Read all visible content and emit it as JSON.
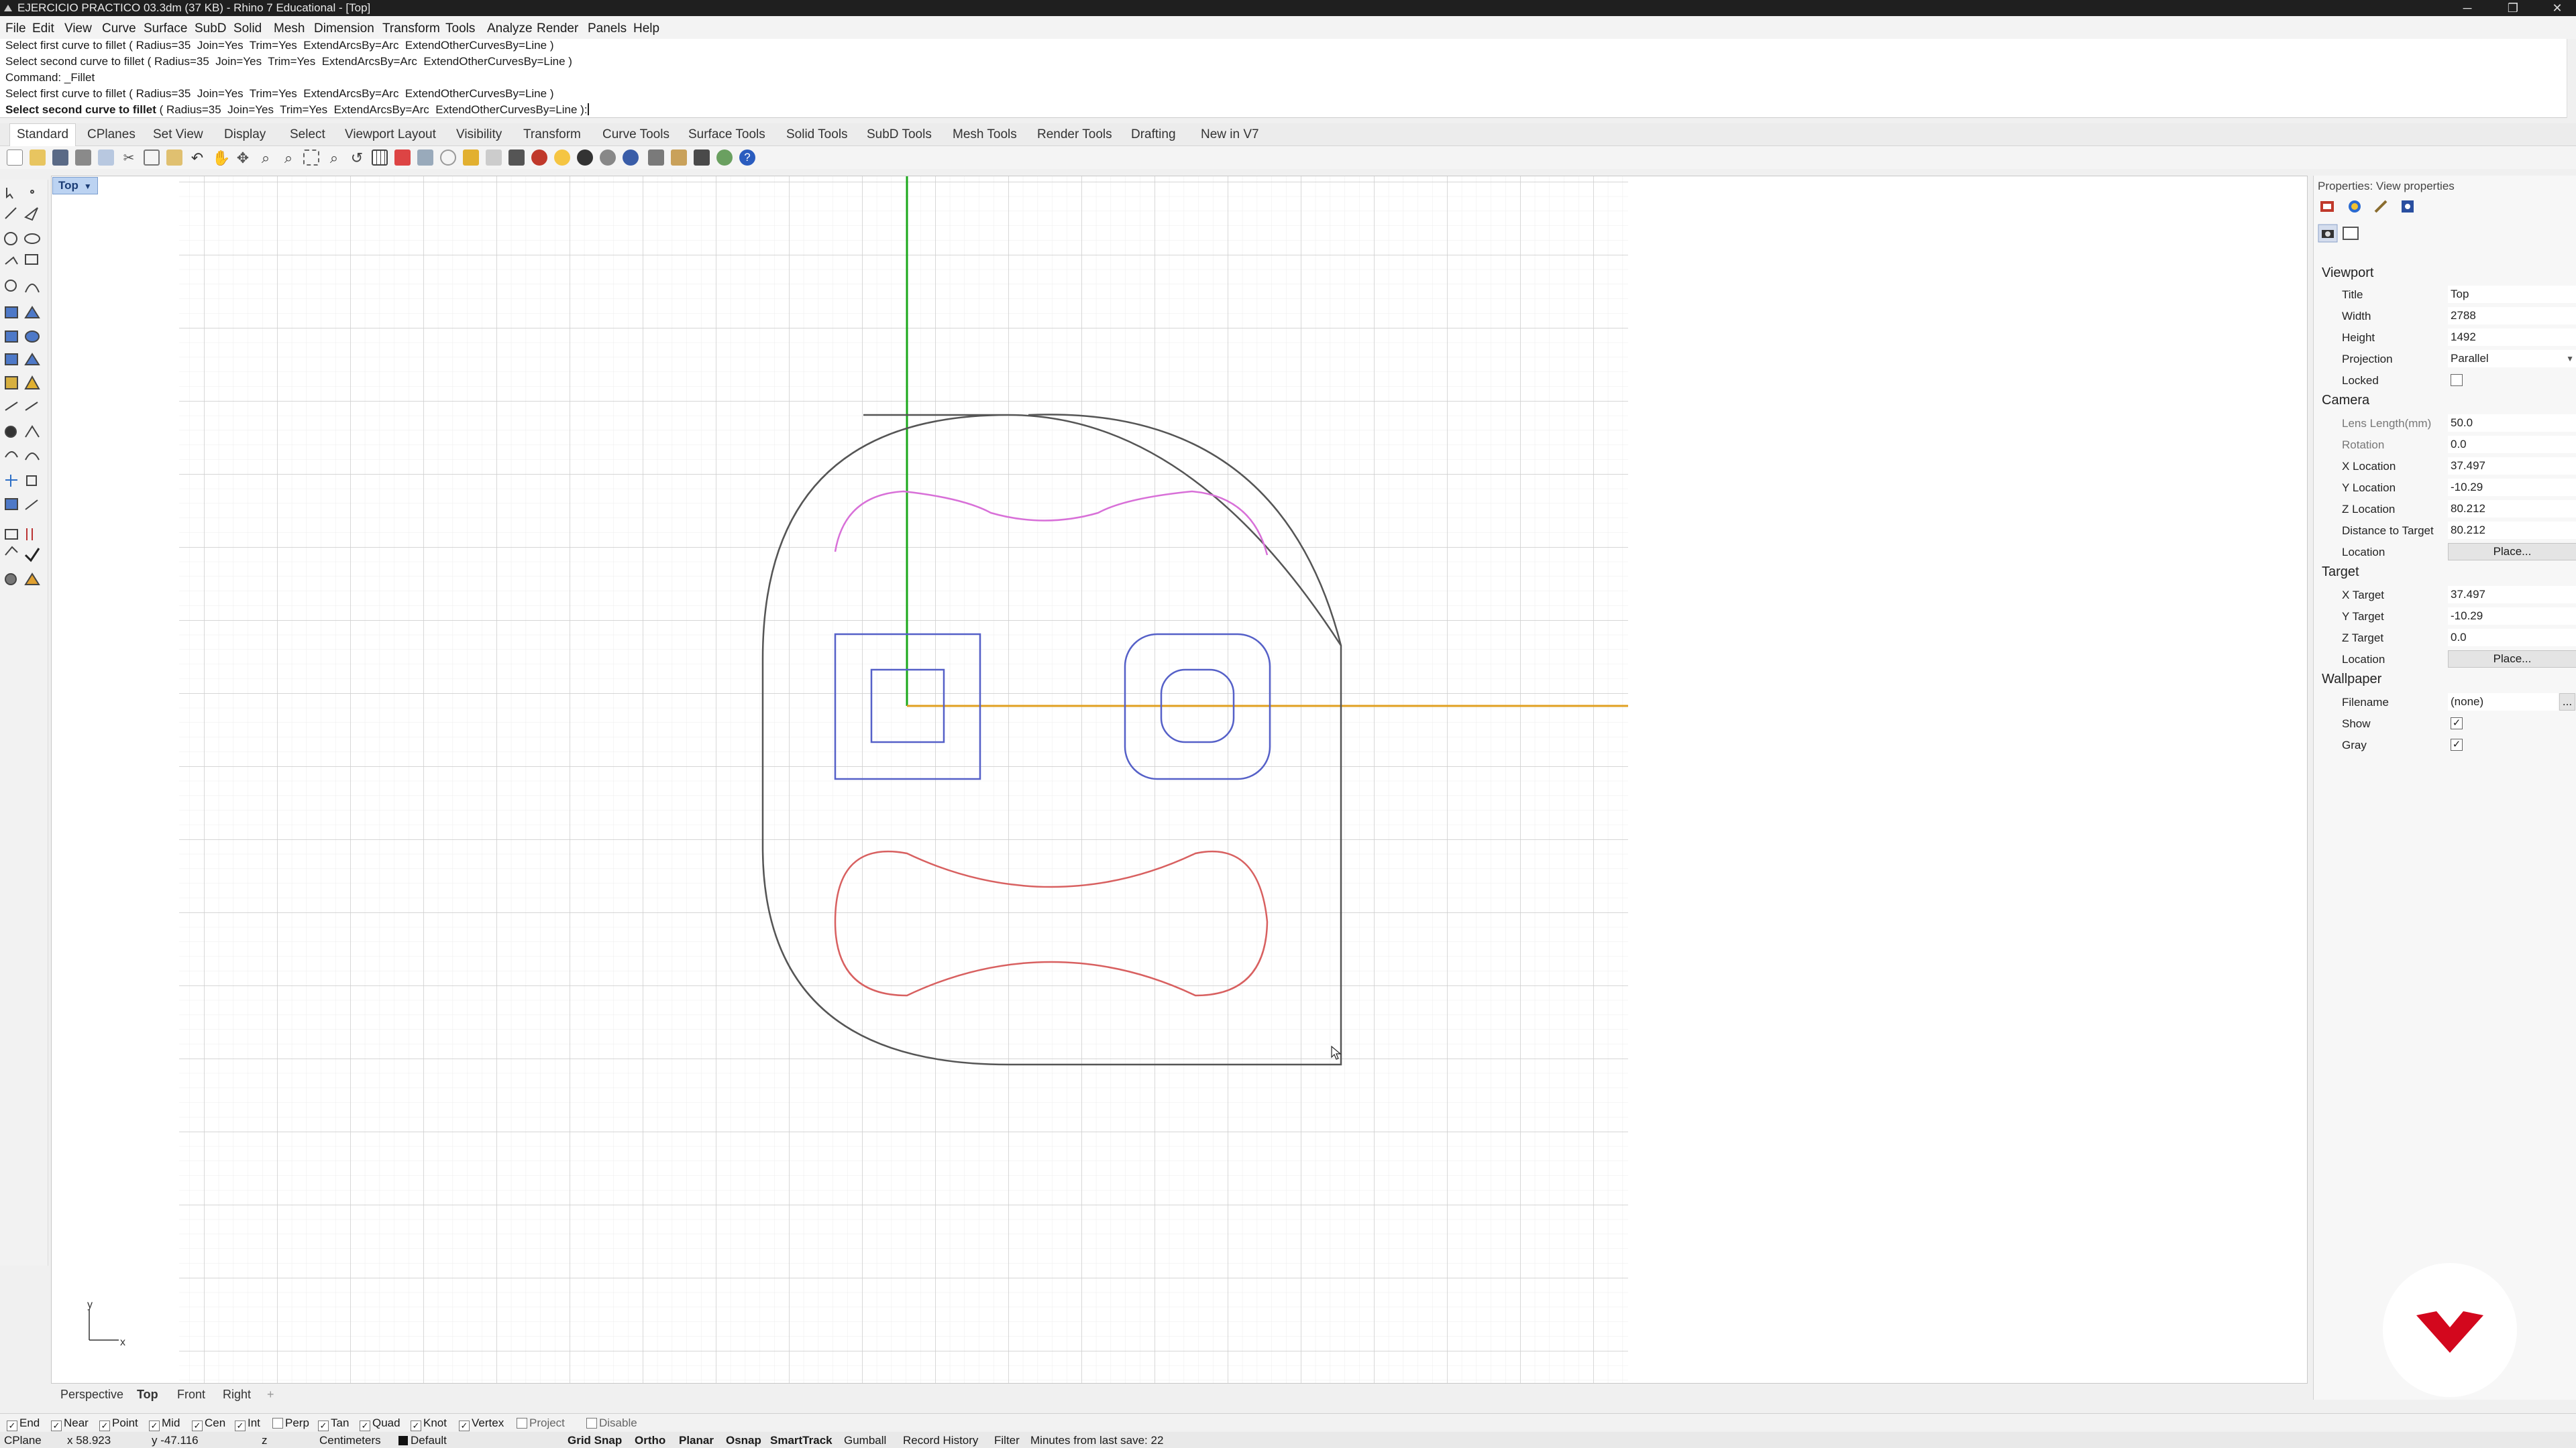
{
  "window": {
    "title": "EJERCICIO PRACTICO 03.3dm (37 KB) - Rhino 7 Educational - [Top]",
    "minimize": "─",
    "restore": "❐",
    "close": "✕"
  },
  "menu": [
    "File",
    "Edit",
    "View",
    "Curve",
    "Surface",
    "SubD",
    "Solid",
    "Mesh",
    "Dimension",
    "Transform",
    "Tools",
    "Analyze",
    "Render",
    "Panels",
    "Help"
  ],
  "command_history": [
    "Select first curve to fillet ( Radius=35  Join=Yes  Trim=Yes  ExtendArcsBy=Arc  ExtendOtherCurvesBy=Line )",
    "Select second curve to fillet ( Radius=35  Join=Yes  Trim=Yes  ExtendArcsBy=Arc  ExtendOtherCurvesBy=Line )",
    "Command: _Fillet",
    "Select first curve to fillet ( Radius=35  Join=Yes  Trim=Yes  ExtendArcsBy=Arc  ExtendOtherCurvesBy=Line )"
  ],
  "command_prompt": {
    "bold": "Select second curve to fillet",
    "rest": " ( Radius=35  Join=Yes  Trim=Yes  ExtendArcsBy=Arc  ExtendOtherCurvesBy=Line ):"
  },
  "toolbar_tabs": [
    "Standard",
    "CPlanes",
    "Set View",
    "Display",
    "Select",
    "Viewport Layout",
    "Visibility",
    "Transform",
    "Curve Tools",
    "Surface Tools",
    "Solid Tools",
    "SubD Tools",
    "Mesh Tools",
    "Render Tools",
    "Drafting",
    "New in V7"
  ],
  "viewport": {
    "name": "Top",
    "axis_y": "y",
    "axis_x": "x",
    "tabs": [
      "Perspective",
      "Top",
      "Front",
      "Right"
    ],
    "add_tab": "+"
  },
  "osnaps": [
    {
      "label": "End",
      "checked": true
    },
    {
      "label": "Near",
      "checked": true
    },
    {
      "label": "Point",
      "checked": true
    },
    {
      "label": "Mid",
      "checked": true
    },
    {
      "label": "Cen",
      "checked": true
    },
    {
      "label": "Int",
      "checked": true
    },
    {
      "label": "Perp",
      "checked": false
    },
    {
      "label": "Tan",
      "checked": true
    },
    {
      "label": "Quad",
      "checked": true
    },
    {
      "label": "Knot",
      "checked": true
    },
    {
      "label": "Vertex",
      "checked": true
    },
    {
      "label": "Project",
      "checked": false
    },
    {
      "label": "Disable",
      "checked": false
    }
  ],
  "status": {
    "cplane": "CPlane",
    "x": "x 58.923",
    "y": "y -47.116",
    "z": "z",
    "units": "Centimeters",
    "layer": "Default",
    "grid_snap": "Grid Snap",
    "ortho": "Ortho",
    "planar": "Planar",
    "osnap": "Osnap",
    "smarttrack": "SmartTrack",
    "gumball": "Gumball",
    "record_history": "Record History",
    "filter": "Filter",
    "save_info": "Minutes from last save: 22"
  },
  "properties": {
    "header": "Properties: View properties",
    "viewport_section": "Viewport",
    "title_label": "Title",
    "title_value": "Top",
    "width_label": "Width",
    "width_value": "2788",
    "height_label": "Height",
    "height_value": "1492",
    "projection_label": "Projection",
    "projection_value": "Parallel",
    "locked_label": "Locked",
    "camera_section": "Camera",
    "lens_label": "Lens Length(mm)",
    "lens_value": "50.0",
    "rotation_label": "Rotation",
    "rotation_value": "0.0",
    "xloc_label": "X Location",
    "xloc_value": "37.497",
    "yloc_label": "Y Location",
    "yloc_value": "-10.29",
    "zloc_label": "Z Location",
    "zloc_value": "80.212",
    "dist_label": "Distance to Target",
    "dist_value": "80.212",
    "cam_location_label": "Location",
    "place_button": "Place...",
    "target_section": "Target",
    "xt_label": "X Target",
    "xt_value": "37.497",
    "yt_label": "Y Target",
    "yt_value": "-10.29",
    "zt_label": "Z Target",
    "zt_value": "0.0",
    "tgt_location_label": "Location",
    "wallpaper_section": "Wallpaper",
    "filename_label": "Filename",
    "filename_value": "(none)",
    "filename_button": "...",
    "show_label": "Show",
    "gray_label": "Gray"
  },
  "colors": {
    "y_axis": "#1aa81a",
    "x_axis": "#e0a020",
    "curve_magenta": "#d870d8",
    "curve_blue": "#5560c8",
    "curve_red": "#d86060",
    "outline": "#555555",
    "brand": "#d3071d"
  }
}
